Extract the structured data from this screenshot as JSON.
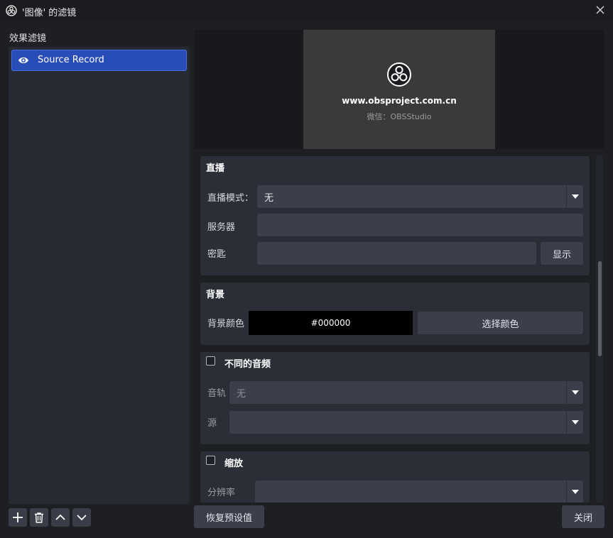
{
  "window": {
    "title": "'图像' 的滤镜"
  },
  "sidebar": {
    "label": "效果滤镜",
    "filters": [
      {
        "name": "Source Record",
        "visible": true
      }
    ]
  },
  "preview": {
    "url": "www.obsproject.com.cn",
    "wechat": "微信：OBSStudio"
  },
  "groups": {
    "stream": {
      "title": "直播",
      "mode_label": "直播模式：",
      "mode_value": "无",
      "server_label": "服务器",
      "server_value": "",
      "key_label": "密匙",
      "key_value": "",
      "show_button": "显示"
    },
    "background": {
      "title": "背景",
      "color_label": "背景颜色",
      "color_value": "#000000",
      "choose_button": "选择颜色"
    },
    "audio": {
      "title": "不同的音频",
      "checked": false,
      "track_label": "音轨",
      "track_value": "无",
      "source_label": "源",
      "source_value": ""
    },
    "scale": {
      "title": "缩放",
      "checked": false,
      "resolution_label": "分辨率",
      "resolution_value": ""
    }
  },
  "footer": {
    "reset_button": "恢复预设值",
    "close_button": "关闭"
  },
  "colors": {
    "accent": "#284cb8",
    "background": "#1e1f22",
    "panel": "#2b2e37"
  }
}
